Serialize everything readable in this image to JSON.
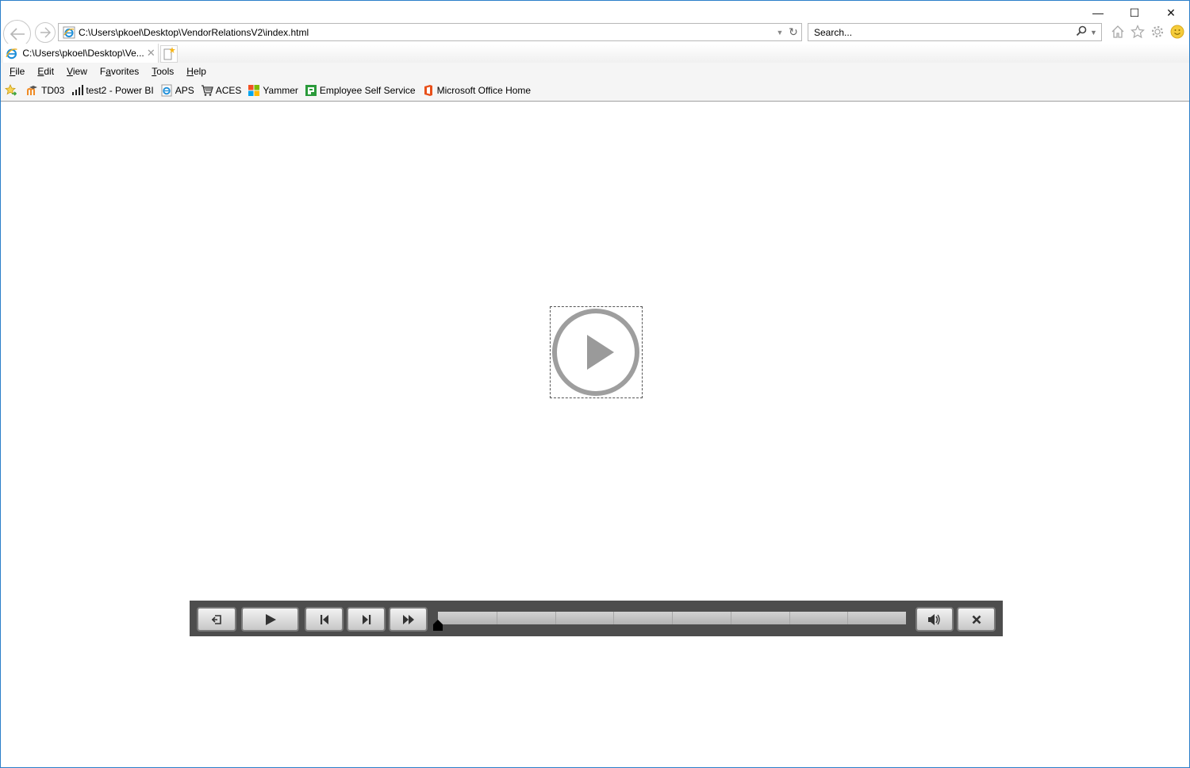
{
  "window": {
    "caption_buttons": [
      {
        "name": "minimize",
        "glyph": "—"
      },
      {
        "name": "maximize",
        "glyph": "☐"
      },
      {
        "name": "close",
        "glyph": "✕"
      }
    ]
  },
  "nav": {
    "back_icon": "back-arrow-icon",
    "forward_icon": "forward-arrow-icon",
    "address": "C:\\Users\\pkoel\\Desktop\\VendorRelationsV2\\index.html",
    "search_placeholder": "Search...",
    "toolbar_icons": [
      "home-icon",
      "favorites-star-icon",
      "settings-gear-icon",
      "feedback-smiley-icon"
    ]
  },
  "tabs": [
    {
      "title": "C:\\Users\\pkoel\\Desktop\\Ve...",
      "active": true
    }
  ],
  "menu": {
    "items": [
      {
        "label": "File",
        "access": "F"
      },
      {
        "label": "Edit",
        "access": "E"
      },
      {
        "label": "View",
        "access": "V"
      },
      {
        "label": "Favorites",
        "access": "a"
      },
      {
        "label": "Tools",
        "access": "T"
      },
      {
        "label": "Help",
        "access": "H"
      }
    ]
  },
  "favorites": {
    "items": [
      {
        "label": "TD03",
        "icon": "moodle-icon"
      },
      {
        "label": "test2 - Power BI",
        "icon": "power-bi-icon"
      },
      {
        "label": "APS",
        "icon": "ie-page-icon"
      },
      {
        "label": "ACES",
        "icon": "shopping-cart-icon"
      },
      {
        "label": "Yammer",
        "icon": "microsoft-logo-icon"
      },
      {
        "label": "Employee Self Service",
        "icon": "ess-icon"
      },
      {
        "label": "Microsoft Office Home",
        "icon": "office-icon"
      }
    ]
  },
  "player": {
    "progress": 0,
    "buttons": [
      "exit",
      "play",
      "previous",
      "next",
      "fast-forward",
      "volume",
      "close"
    ],
    "segments": 8
  },
  "colors": {
    "window_border": "#2b7fc9",
    "player_bg": "#4d4d4d",
    "play_icon": "#9a9a9a"
  }
}
